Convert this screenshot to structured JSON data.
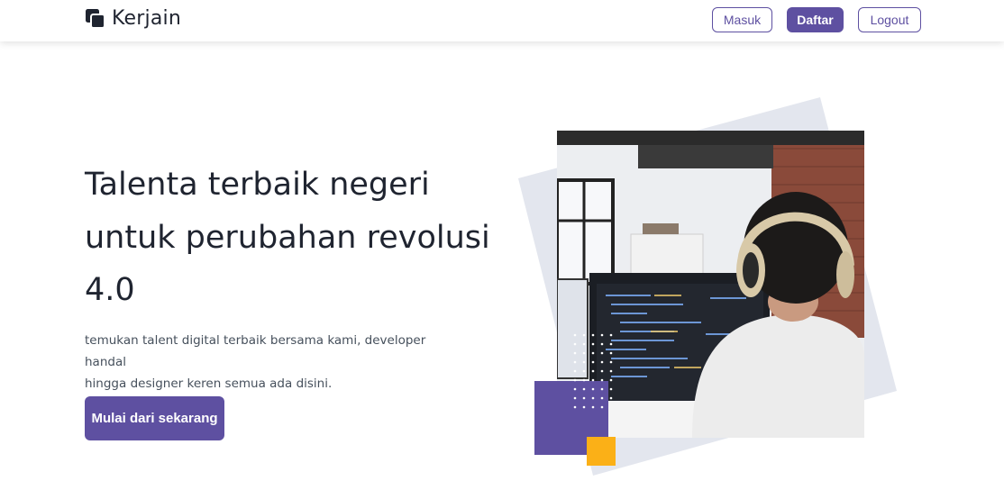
{
  "brand": {
    "name": "Kerjain",
    "logo_icon": "kerjain-logo-icon"
  },
  "nav": {
    "login_label": "Masuk",
    "register_label": "Daftar",
    "logout_label": "Logout"
  },
  "hero": {
    "title_lines": [
      "Talenta terbaik negeri",
      "untuk perubahan revolusi",
      "4.0"
    ],
    "subtitle_lines": [
      "temukan talent digital terbaik bersama kami, developer handal",
      "hingga designer keren semua ada disini."
    ],
    "cta_label": "Mulai dari sekarang"
  },
  "colors": {
    "primary": "#5e50a1",
    "accent": "#fbb017",
    "tilt_bg": "#e3e6ee",
    "text_dark": "#1f2430"
  }
}
